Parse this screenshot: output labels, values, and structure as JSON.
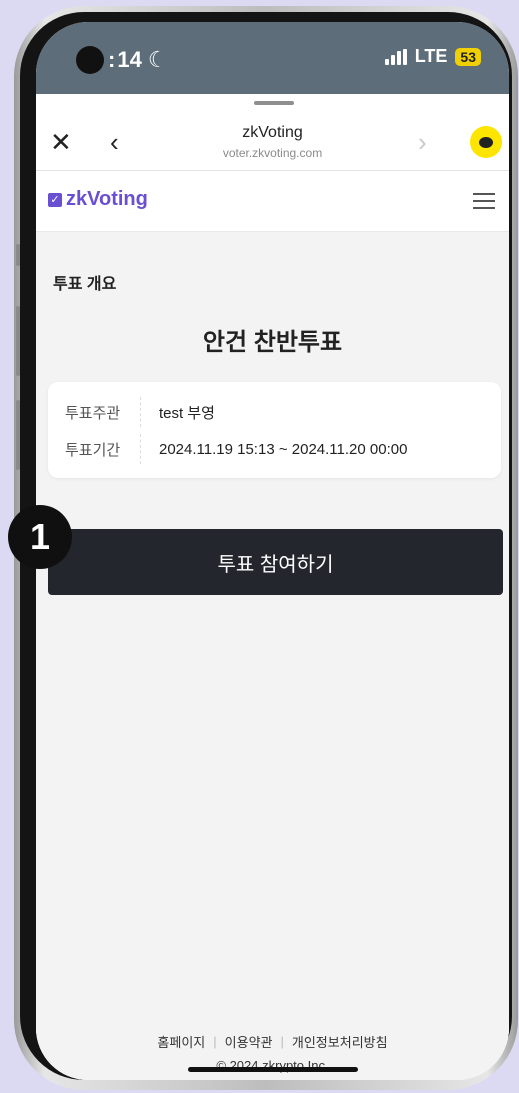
{
  "status_bar": {
    "time": "14",
    "network": "LTE",
    "battery": "53"
  },
  "browser": {
    "title": "zkVoting",
    "url": "voter.zkvoting.com",
    "close_icon": "close-icon",
    "back_icon": "chevron-left-icon",
    "forward_icon": "chevron-right-icon",
    "kakao_icon": "chat-bubble-icon"
  },
  "site": {
    "logo_text": "zkVoting",
    "brand_color": "#6a4fd3",
    "menu_icon": "hamburger-icon"
  },
  "content": {
    "section_label": "투표 개요",
    "vote_title": "안건 찬반투표",
    "info": [
      {
        "key": "투표주관",
        "value": "test 부영"
      },
      {
        "key": "투표기간",
        "value": "2024.11.19 15:13 ~ 2024.11.20 00:00"
      }
    ],
    "participate_button": "투표 참여하기"
  },
  "footer": {
    "links": [
      "홈페이지",
      "이용약관",
      "개인정보처리방침"
    ],
    "copyright": "© 2024 zkrypto Inc."
  },
  "step_badge": "1"
}
